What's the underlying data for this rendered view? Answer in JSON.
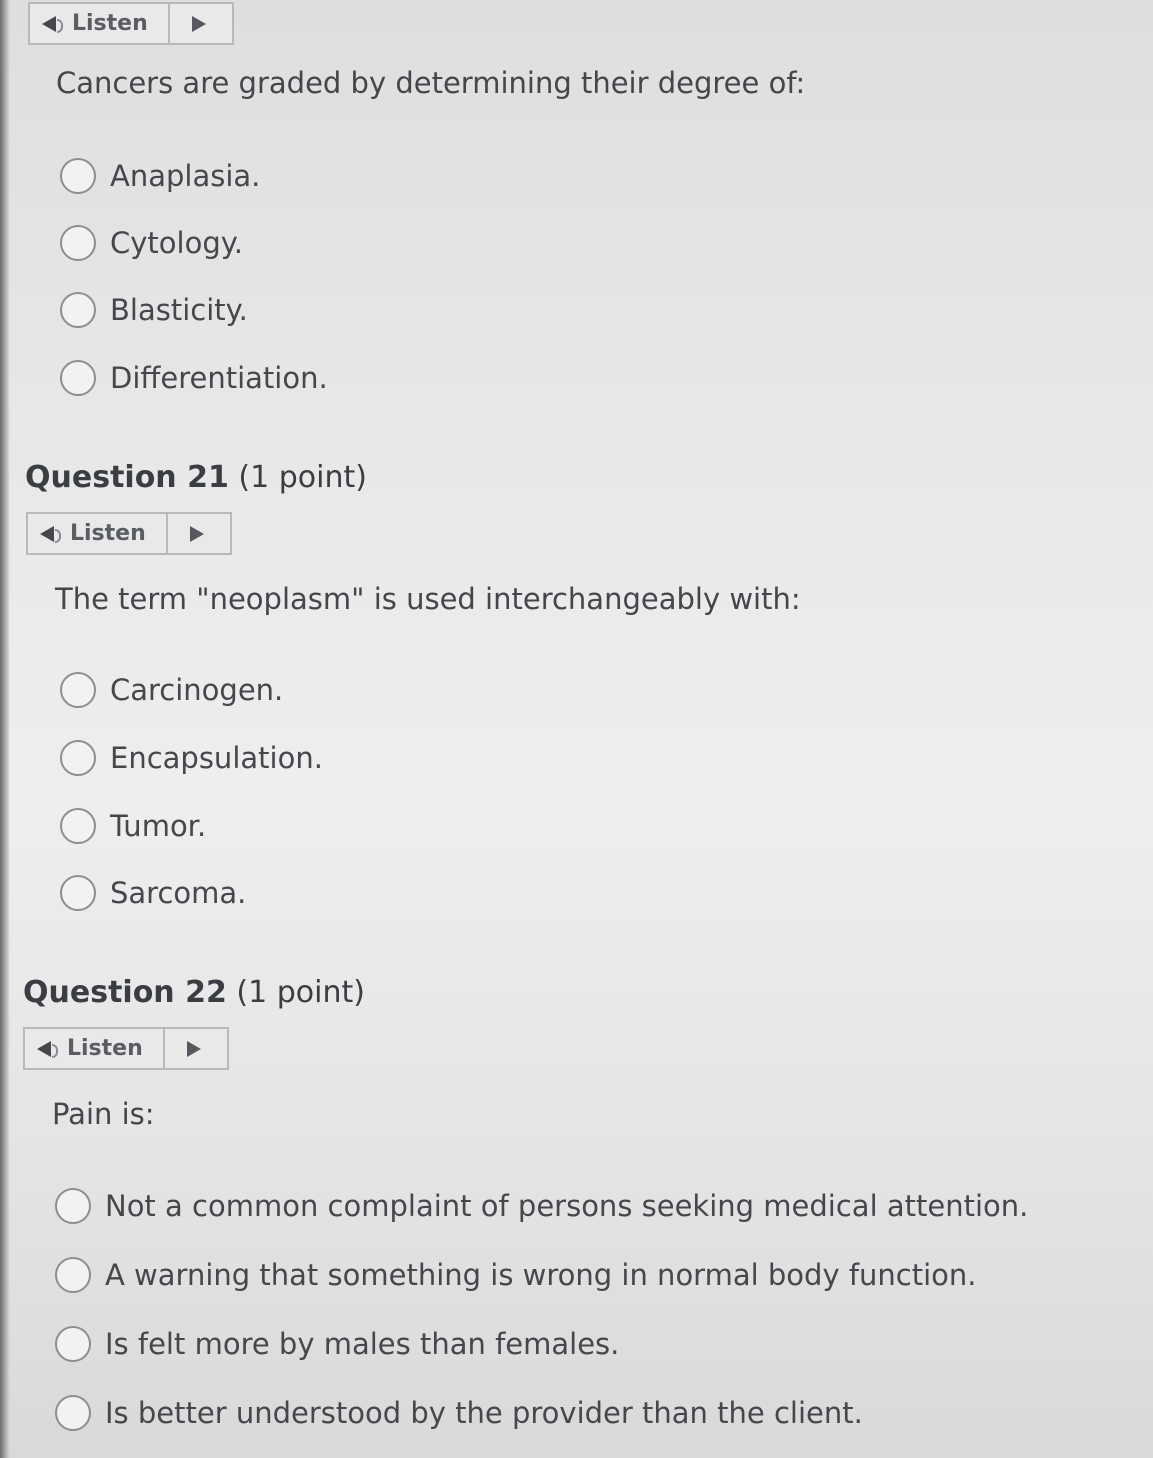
{
  "listen_label": "Listen",
  "questions": [
    {
      "header_bold": "",
      "header_points": "",
      "prompt": "Cancers are graded by determining their degree of:",
      "options": [
        "Anaplasia.",
        "Cytology.",
        "Blasticity.",
        "Differentiation."
      ]
    },
    {
      "header_bold": "Question 21",
      "header_points": "(1 point)",
      "prompt": "The term \"neoplasm\" is used interchangeably with:",
      "options": [
        "Carcinogen.",
        "Encapsulation.",
        "Tumor.",
        "Sarcoma."
      ]
    },
    {
      "header_bold": "Question 22",
      "header_points": "(1 point)",
      "prompt": "Pain is:",
      "options": [
        "Not a common complaint of persons seeking medical attention.",
        "A warning that something is wrong in normal body function.",
        "Is felt more by males than females.",
        "Is better understood by the provider than the client."
      ]
    }
  ]
}
